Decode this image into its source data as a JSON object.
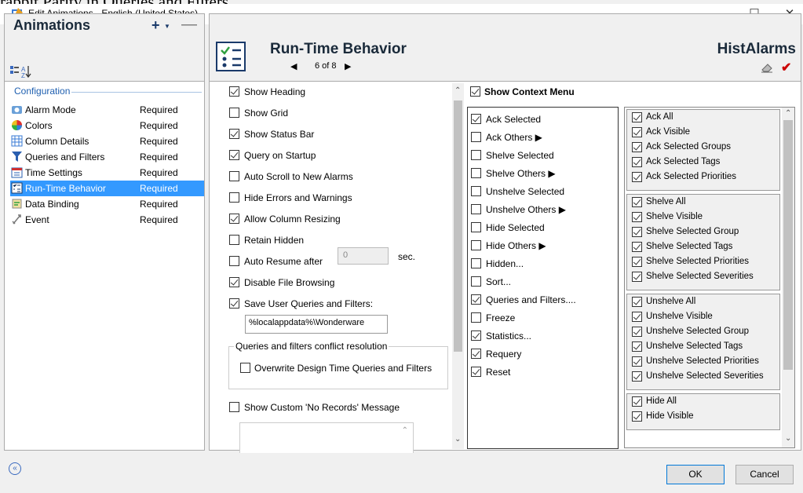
{
  "top_fragment": "rabbit Parity in Queries and Filters.",
  "window": {
    "title": "Edit Animations - English (United States)",
    "minimize": "—",
    "maximize": "☐",
    "close": "✕"
  },
  "left_panel": {
    "title": "Animations",
    "add": "+",
    "remove": "—",
    "section_header": "Configuration",
    "items": [
      {
        "name": "Alarm Mode",
        "status": "Required"
      },
      {
        "name": "Colors",
        "status": "Required"
      },
      {
        "name": "Column Details",
        "status": "Required"
      },
      {
        "name": "Queries and Filters",
        "status": "Required"
      },
      {
        "name": "Time Settings",
        "status": "Required"
      },
      {
        "name": "Run-Time Behavior",
        "status": "Required"
      },
      {
        "name": "Data Binding",
        "status": "Required"
      },
      {
        "name": "Event",
        "status": "Required"
      }
    ]
  },
  "main": {
    "title": "Run-Time Behavior",
    "nav_prev": "◀",
    "nav_count": "6 of 8",
    "nav_next": "▶",
    "object_name": "HistAlarms",
    "options": [
      {
        "label": "Show Heading",
        "checked": true
      },
      {
        "label": "Show Grid",
        "checked": false
      },
      {
        "label": "Show Status Bar",
        "checked": true
      },
      {
        "label": "Query on Startup",
        "checked": true
      },
      {
        "label": "Auto Scroll to New Alarms",
        "checked": false
      },
      {
        "label": "Hide Errors and Warnings",
        "checked": false
      },
      {
        "label": "Allow Column Resizing",
        "checked": true
      },
      {
        "label": "Retain Hidden",
        "checked": false
      },
      {
        "label": "Auto Resume after",
        "checked": false
      },
      {
        "label": "Disable File Browsing",
        "checked": true
      },
      {
        "label": "Save User Queries and Filters:",
        "checked": true
      }
    ],
    "auto_resume_value": "0",
    "auto_resume_unit": "sec.",
    "save_path": "%localappdata%\\Wonderware",
    "conflict_group_label": "Queries and filters conflict resolution",
    "overwrite_label": "Overwrite Design Time Queries and Filters",
    "custom_message_label": "Show Custom 'No Records' Message",
    "context_menu": {
      "label": "Show Context Menu",
      "items": [
        {
          "label": "Ack Selected",
          "checked": true
        },
        {
          "label": "Ack Others ▶",
          "checked": false
        },
        {
          "label": "Shelve Selected",
          "checked": false
        },
        {
          "label": "Shelve Others ▶",
          "checked": false
        },
        {
          "label": "Unshelve Selected",
          "checked": false
        },
        {
          "label": "Unshelve Others ▶",
          "checked": false
        },
        {
          "label": "Hide Selected",
          "checked": false
        },
        {
          "label": "Hide Others ▶",
          "checked": false
        },
        {
          "label": "Hidden...",
          "checked": false
        },
        {
          "label": "Sort...",
          "checked": false
        },
        {
          "label": "Queries and Filters....",
          "checked": true
        },
        {
          "label": "Freeze",
          "checked": false
        },
        {
          "label": "Statistics...",
          "checked": true
        },
        {
          "label": "Requery",
          "checked": true
        },
        {
          "label": "Reset",
          "checked": true
        }
      ]
    },
    "sub_groups": [
      [
        "Ack All",
        "Ack Visible",
        "Ack Selected Groups",
        "Ack Selected Tags",
        "Ack Selected Priorities"
      ],
      [
        "Shelve All",
        "Shelve Visible",
        "Shelve Selected Group",
        "Shelve Selected Tags",
        "Shelve Selected Priorities",
        "Shelve Selected Severities"
      ],
      [
        "Unshelve All",
        "Unshelve Visible",
        "Unshelve Selected Group",
        "Unshelve Selected Tags",
        "Unshelve Selected Priorities",
        "Unshelve Selected Severities"
      ],
      [
        "Hide All",
        "Hide Visible"
      ]
    ]
  },
  "buttons": {
    "ok": "OK",
    "cancel": "Cancel",
    "collapse": "«"
  }
}
